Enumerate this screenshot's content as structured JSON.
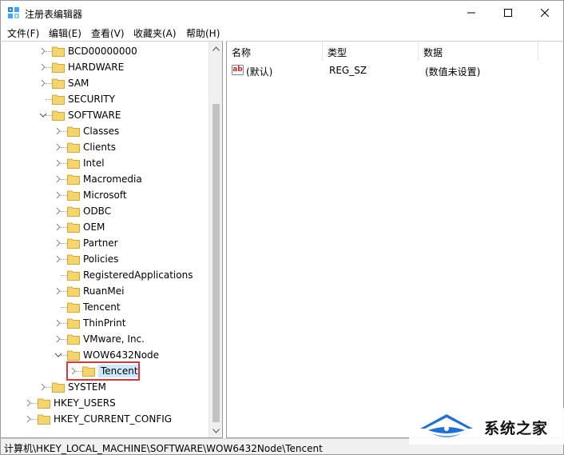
{
  "window": {
    "title": "注册表编辑器",
    "controls": {
      "minimize": "minimize",
      "maximize": "maximize",
      "close": "close"
    }
  },
  "menu": [
    {
      "label": "文件(F)"
    },
    {
      "label": "编辑(E)"
    },
    {
      "label": "查看(V)"
    },
    {
      "label": "收藏夹(A)"
    },
    {
      "label": "帮助(H)"
    }
  ],
  "tree": {
    "items": [
      {
        "label": "BCD00000000",
        "expander": "collapsed"
      },
      {
        "label": "HARDWARE",
        "expander": "collapsed"
      },
      {
        "label": "SAM",
        "expander": "collapsed"
      },
      {
        "label": "SECURITY",
        "expander": "none"
      },
      {
        "label": "SOFTWARE",
        "expander": "expanded"
      },
      {
        "label": "Classes",
        "expander": "collapsed"
      },
      {
        "label": "Clients",
        "expander": "collapsed"
      },
      {
        "label": "Intel",
        "expander": "collapsed"
      },
      {
        "label": "Macromedia",
        "expander": "collapsed"
      },
      {
        "label": "Microsoft",
        "expander": "collapsed"
      },
      {
        "label": "ODBC",
        "expander": "collapsed"
      },
      {
        "label": "OEM",
        "expander": "collapsed"
      },
      {
        "label": "Partner",
        "expander": "collapsed"
      },
      {
        "label": "Policies",
        "expander": "collapsed"
      },
      {
        "label": "RegisteredApplications",
        "expander": "none"
      },
      {
        "label": "RuanMei",
        "expander": "collapsed"
      },
      {
        "label": "Tencent",
        "expander": "none"
      },
      {
        "label": "ThinPrint",
        "expander": "collapsed"
      },
      {
        "label": "VMware, Inc.",
        "expander": "collapsed"
      },
      {
        "label": "WOW6432Node",
        "expander": "expanded"
      },
      {
        "label": "Tencent",
        "expander": "collapsed",
        "selected": true
      },
      {
        "label": "SYSTEM",
        "expander": "collapsed"
      },
      {
        "label": "HKEY_USERS",
        "expander": "collapsed"
      },
      {
        "label": "HKEY_CURRENT_CONFIG",
        "expander": "collapsed"
      }
    ]
  },
  "list": {
    "columns": [
      {
        "label": "名称"
      },
      {
        "label": "类型"
      },
      {
        "label": "数据"
      }
    ],
    "rows": [
      {
        "icon": "ab-string-icon",
        "name": "(默认)",
        "type": "REG_SZ",
        "data": "(数值未设置)"
      }
    ]
  },
  "status": {
    "path": "计算机\\HKEY_LOCAL_MACHINE\\SOFTWARE\\WOW6432Node\\Tencent"
  },
  "watermark": {
    "text": "系统之家"
  },
  "colors": {
    "selection": "#cce8ff",
    "highlight_box": "#d9373b",
    "folder": "#f4d46b",
    "watermark_blue": "#1e6fd9"
  }
}
